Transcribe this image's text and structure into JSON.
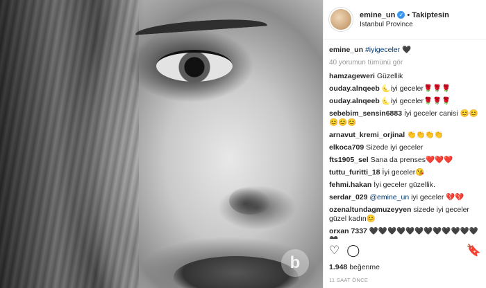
{
  "post": {
    "username": "emine_un",
    "verified_mark": "✓",
    "separator": "•",
    "follow_status": "Takiptesin",
    "location": "Istanbul Province",
    "photo_watermark": "b"
  },
  "caption": {
    "user": "emine_un",
    "hashtag": "#iyigeceler",
    "emoji": "🖤"
  },
  "load_more": "40 yorumun tümünü gör",
  "comments": [
    {
      "user": "hamzageweri",
      "text": "Güzellik"
    },
    {
      "user": "ouday.alnqeeb",
      "text": "🌜iyi geceler🌹🌹🌹"
    },
    {
      "user": "ouday.alnqeeb",
      "text": "🌜iyi geceler🌹🌹🌹"
    },
    {
      "user": "sebebim_sensin6883",
      "text": "İyi geceler canisi 😊😊😊😊😊"
    },
    {
      "user": "arnavut_kremi_orjinal",
      "text": "👏👏👏👏"
    },
    {
      "user": "elkoca709",
      "text": "Sizede iyi geceler"
    },
    {
      "user": "fts1905_sel",
      "text": "Sana da prenses❤️❤️❤️"
    },
    {
      "user": "tuttu_furitti_18",
      "text": "İyi geceler😘"
    },
    {
      "user": "fehmi.hakan",
      "text": "İyi geceler güzellik."
    },
    {
      "user": "serdar_029",
      "mention": "@emine_un",
      "text": "iyi geceler 💔💔"
    },
    {
      "user": "ozenaltundagmuzeyyen",
      "text": "sizede iyi geceler güzel kadın😊"
    },
    {
      "user": "orxan 7337",
      "text": "🖤🖤🖤🖤🖤🖤🖤🖤🖤🖤🖤🖤🖤"
    }
  ],
  "actions": {
    "like_icon": "♡",
    "comment_icon": "◯",
    "save_icon": "🔖"
  },
  "likes": {
    "count": "1.948",
    "label": "beğenme"
  },
  "timestamp": "11 SAAT ÖNCE"
}
